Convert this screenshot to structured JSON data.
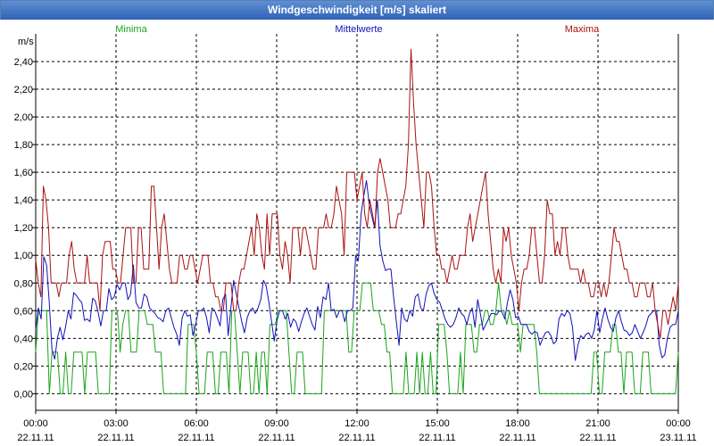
{
  "window": {
    "title": "Windgeschwindigkeit [m/s] skaliert"
  },
  "chart_data": {
    "type": "line",
    "title": "Windgeschwindigkeit [m/s] skaliert",
    "ylabel": "m/s",
    "xlabel": "",
    "ylim": [
      -0.12,
      2.6
    ],
    "xlim": [
      0,
      24
    ],
    "grid": true,
    "legend": "top",
    "y_ticks": [
      "0,00",
      "0,20",
      "0,40",
      "0,60",
      "0,80",
      "1,00",
      "1,20",
      "1,40",
      "1,60",
      "1,80",
      "2,00",
      "2,20",
      "2,40"
    ],
    "y_tick_values": [
      0,
      0.2,
      0.4,
      0.6,
      0.8,
      1.0,
      1.2,
      1.4,
      1.6,
      1.8,
      2.0,
      2.2,
      2.4
    ],
    "x_ticks": [
      {
        "time": "00:00",
        "date": "22.11.11"
      },
      {
        "time": "03:00",
        "date": "22.11.11"
      },
      {
        "time": "06:00",
        "date": "22.11.11"
      },
      {
        "time": "09:00",
        "date": "22.11.11"
      },
      {
        "time": "12:00",
        "date": "22.11.11"
      },
      {
        "time": "15:00",
        "date": "22.11.11"
      },
      {
        "time": "18:00",
        "date": "22.11.11"
      },
      {
        "time": "21:00",
        "date": "22.11.11"
      },
      {
        "time": "00:00",
        "date": "23.11.11"
      }
    ],
    "series_colors": {
      "min": "#1aa51a",
      "mean": "#1010b8",
      "max": "#aa1010"
    },
    "series": [
      {
        "name": "Minima",
        "color": "#1aa51a",
        "values": [
          0.3,
          0.6,
          0.6,
          0.6,
          0.6,
          0,
          0.3,
          0.3,
          0.3,
          0,
          0,
          0.3,
          0,
          0,
          0.3,
          0.3,
          0.3,
          0.3,
          0,
          0.3,
          0.3,
          0.3,
          0.3,
          0,
          0,
          0,
          0,
          0,
          0.6,
          0.6,
          0.6,
          0.3,
          0.5,
          0.6,
          0.6,
          0.3,
          0.3,
          0.3,
          0.6,
          0.6,
          0.6,
          0.5,
          0.5,
          0.5,
          0.3,
          0.3,
          0.3,
          0,
          0,
          0,
          0,
          0,
          0,
          0,
          0,
          0,
          0.5,
          0.5,
          0.5,
          0.3,
          0,
          0,
          0,
          0.3,
          0.3,
          0.3,
          0,
          0,
          0.3,
          0.3,
          0.3,
          0,
          0.6,
          0.6,
          0.3,
          0,
          0.3,
          0.3,
          0.3,
          0,
          0,
          0.3,
          0,
          0.3,
          0.3,
          0,
          0.5,
          0.5,
          0.5,
          0.6,
          0.6,
          0.6,
          0.6,
          0.3,
          0,
          0,
          0.3,
          0.3,
          0.3,
          0,
          0,
          0,
          0,
          0,
          0,
          0,
          0.6,
          0.6,
          0.6,
          0.6,
          0.6,
          0.6,
          0.6,
          0.6,
          0.6,
          0.3,
          0.3,
          0.6,
          0.6,
          0.6,
          0.8,
          0.8,
          0.8,
          0.8,
          0.6,
          0.6,
          0.6,
          0.5,
          0.5,
          0.3,
          0.3,
          0,
          0,
          0,
          0,
          0,
          0.3,
          0,
          0,
          0,
          0.3,
          0,
          0.3,
          0,
          0,
          0.3,
          0,
          0,
          0.5,
          0.5,
          0.5,
          0.3,
          0,
          0,
          0,
          0,
          0.3,
          0,
          0.5,
          0.5,
          0.5,
          0.3,
          0.3,
          0.5,
          0.5,
          0.6,
          0.6,
          0.5,
          0.5,
          0.6,
          0.8,
          0.6,
          0.6,
          0.5,
          0.6,
          0.5,
          0.5,
          0.5,
          0.3,
          0.5,
          0.5,
          0.5,
          0.5,
          0.5,
          0.3,
          0,
          0,
          0,
          0,
          0,
          0,
          0,
          0,
          0,
          0,
          0,
          0,
          0,
          0,
          0,
          0,
          0,
          0,
          0,
          0,
          0.3,
          0.3,
          0,
          0,
          0.3,
          0.3,
          0.3,
          0.5,
          0.5,
          0.3,
          0.3,
          0,
          0.3,
          0.3,
          0.3,
          0,
          0,
          0,
          0.3,
          0.3,
          0.3,
          0,
          0,
          0,
          0,
          0,
          0,
          0,
          0,
          0,
          0,
          0.3
        ]
      },
      {
        "name": "Mittelwerte",
        "color": "#1010b8",
        "values": [
          0.46,
          0.62,
          0.54,
          0.99,
          0.93,
          0.66,
          0.32,
          0.25,
          0.4,
          0.48,
          0.39,
          0.48,
          0.6,
          0.54,
          0.73,
          0.71,
          0.68,
          0.66,
          0.53,
          0.54,
          0.52,
          0.69,
          0.67,
          0.59,
          0.49,
          0.6,
          0.6,
          0.76,
          0.68,
          0.7,
          0.79,
          0.75,
          0.8,
          0.8,
          0.68,
          0.72,
          0.93,
          0.66,
          0.62,
          0.62,
          0.72,
          0.7,
          0.62,
          0.6,
          0.58,
          0.55,
          0.54,
          0.52,
          0.6,
          0.62,
          0.55,
          0.48,
          0.43,
          0.35,
          0.55,
          0.6,
          0.56,
          0.57,
          0.42,
          0.5,
          0.6,
          0.6,
          0.62,
          0.55,
          0.44,
          0.62,
          0.6,
          0.55,
          0.49,
          0.68,
          0.72,
          0.42,
          0.62,
          0.82,
          0.72,
          0.62,
          0.52,
          0.44,
          0.55,
          0.6,
          0.62,
          0.58,
          0.62,
          0.68,
          0.82,
          0.78,
          0.66,
          0.52,
          0.38,
          0.53,
          0.6,
          0.6,
          0.54,
          0.58,
          0.48,
          0.54,
          0.52,
          0.45,
          0.52,
          0.58,
          0.62,
          0.56,
          0.5,
          0.46,
          0.63,
          0.55,
          0.7,
          0.68,
          0.8,
          0.6,
          0.61,
          0.55,
          0.6,
          0.6,
          0.52,
          0.6,
          0.6,
          0.62,
          1.0,
          0.96,
          1.3,
          1.43,
          1.54,
          1.37,
          1.28,
          1.2,
          1.4,
          1.07,
          0.96,
          0.89,
          0.9,
          0.9,
          0.7,
          0.52,
          0.35,
          0.62,
          0.54,
          0.52,
          0.6,
          0.56,
          0.7,
          0.72,
          0.62,
          0.6,
          0.72,
          0.78,
          0.8,
          0.72,
          0.68,
          0.66,
          0.6,
          0.54,
          0.5,
          0.48,
          0.5,
          0.55,
          0.62,
          0.58,
          0.56,
          0.5,
          0.58,
          0.62,
          0.48,
          0.68,
          0.58,
          0.46,
          0.5,
          0.54,
          0.58,
          0.58,
          0.57,
          0.6,
          0.59,
          0.54,
          0.66,
          0.75,
          0.68,
          0.55,
          0.56,
          0.5,
          0.5,
          0.5,
          0.45,
          0.43,
          0.45,
          0.44,
          0.35,
          0.4,
          0.44,
          0.45,
          0.42,
          0.36,
          0.38,
          0.54,
          0.58,
          0.56,
          0.6,
          0.58,
          0.48,
          0.24,
          0.35,
          0.42,
          0.4,
          0.43,
          0.44,
          0.4,
          0.46,
          0.6,
          0.44,
          0.54,
          0.62,
          0.54,
          0.48,
          0.45,
          0.55,
          0.6,
          0.52,
          0.46,
          0.45,
          0.42,
          0.44,
          0.5,
          0.45,
          0.4,
          0.44,
          0.49,
          0.56,
          0.58,
          0.6,
          0.6,
          0.35,
          0.26,
          0.28,
          0.4,
          0.48,
          0.5,
          0.5,
          0.6
        ]
      },
      {
        "name": "Maxima",
        "color": "#aa1010",
        "values": [
          0.97,
          0.8,
          0.7,
          1.5,
          1.4,
          1.2,
          0.8,
          0.8,
          0.8,
          0.7,
          0.8,
          0.8,
          0.8,
          1.0,
          1.1,
          0.9,
          0.8,
          0.8,
          0.8,
          0.8,
          1.0,
          0.8,
          0.8,
          0.8,
          0.8,
          0.6,
          1.0,
          1.1,
          1.1,
          1.1,
          0.9,
          0.9,
          0.8,
          0.8,
          1.0,
          1.2,
          1.2,
          1.2,
          0.8,
          0.8,
          1.2,
          1.2,
          0.9,
          0.9,
          0.9,
          1.5,
          1.5,
          1.2,
          0.9,
          1.2,
          1.3,
          1.1,
          0.9,
          0.8,
          0.8,
          0.8,
          1.0,
          1.0,
          0.9,
          0.9,
          1.0,
          1.0,
          0.9,
          0.8,
          0.9,
          1.0,
          1.0,
          1.0,
          0.8,
          0.8,
          0.7,
          0.7,
          0.6,
          0.6,
          0.8,
          0.8,
          0.8,
          0.6,
          0.6,
          0.8,
          0.9,
          0.9,
          1.0,
          1.1,
          1.2,
          1.0,
          1.3,
          1.2,
          1.0,
          0.9,
          1.3,
          1.0,
          1.3,
          1.3,
          1.3,
          1.0,
          0.9,
          1.1,
          1.0,
          0.8,
          1.2,
          1.2,
          1.2,
          1.0,
          1.2,
          1.2,
          1.1,
          1.0,
          0.9,
          0.9,
          1.2,
          1.2,
          1.2,
          1.3,
          1.2,
          1.2,
          1.3,
          1.5,
          1.4,
          1.3,
          1.0,
          1.6,
          1.6,
          1.6,
          1.6,
          1.4,
          1.5,
          1.6,
          1.3,
          1.2,
          1.4,
          1.3,
          1.2,
          1.6,
          1.7,
          1.6,
          1.5,
          1.4,
          1.2,
          1.2,
          1.2,
          1.3,
          1.3,
          1.4,
          1.5,
          1.8,
          2.49,
          2.1,
          1.8,
          1.6,
          1.4,
          1.2,
          1.6,
          1.6,
          1.5,
          1.2,
          1.0,
          1.0,
          0.9,
          0.9,
          0.8,
          0.9,
          1.0,
          0.9,
          0.9,
          1.0,
          1.0,
          1.0,
          1.2,
          1.3,
          1.1,
          1.2,
          1.3,
          1.4,
          1.5,
          1.6,
          1.3,
          1.1,
          0.9,
          0.8,
          0.9,
          0.8,
          1.2,
          1.1,
          1.2,
          1.0,
          0.9,
          0.8,
          0.6,
          0.8,
          0.9,
          0.9,
          1.0,
          1.2,
          1.2,
          1.0,
          0.8,
          0.8,
          1.0,
          1.4,
          1.3,
          1.3,
          1.0,
          1.1,
          1.0,
          1.2,
          1.2,
          1.0,
          0.9,
          0.9,
          0.9,
          0.9,
          0.8,
          0.9,
          0.8,
          0.8,
          0.7,
          0.7,
          0.8,
          0.8,
          0.7,
          0.8,
          0.7,
          0.8,
          1.0,
          1.2,
          1.1,
          1.1,
          1.0,
          0.9,
          0.9,
          0.8,
          0.8,
          0.7,
          0.7,
          0.8,
          0.8,
          0.8,
          0.7,
          0.7,
          0.8,
          0.6,
          0.5,
          0.4,
          0.6,
          0.6,
          0.5,
          0.6,
          0.7,
          0.6,
          0.8
        ]
      }
    ]
  }
}
